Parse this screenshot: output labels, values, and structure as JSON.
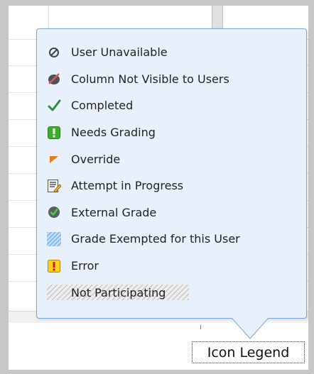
{
  "legend": {
    "items": [
      {
        "icon": "user-unavailable-icon",
        "label": "User Unavailable"
      },
      {
        "icon": "column-not-visible-icon",
        "label": "Column Not Visible to Users"
      },
      {
        "icon": "completed-checkmark-icon",
        "label": "Completed"
      },
      {
        "icon": "needs-grading-icon",
        "label": "Needs Grading"
      },
      {
        "icon": "override-icon",
        "label": "Override"
      },
      {
        "icon": "attempt-in-progress-icon",
        "label": "Attempt in Progress"
      },
      {
        "icon": "external-grade-icon",
        "label": "External Grade"
      },
      {
        "icon": "grade-exempted-icon",
        "label": "Grade Exempted for this User"
      },
      {
        "icon": "error-icon",
        "label": "Error"
      },
      {
        "icon": "not-participating-icon",
        "label": "Not Participating"
      }
    ]
  },
  "button": {
    "label": "Icon Legend"
  },
  "colors": {
    "popover_bg": "#e8f1fb",
    "popover_border": "#7ea7cf",
    "completed_green": "#2e8b3e",
    "needs_grading_green": "#3cae29",
    "override_orange": "#e67e1a",
    "error_red": "#cc1a1a",
    "error_yellow": "#ffd21f",
    "exempt_blue": "#8cc0ef"
  }
}
